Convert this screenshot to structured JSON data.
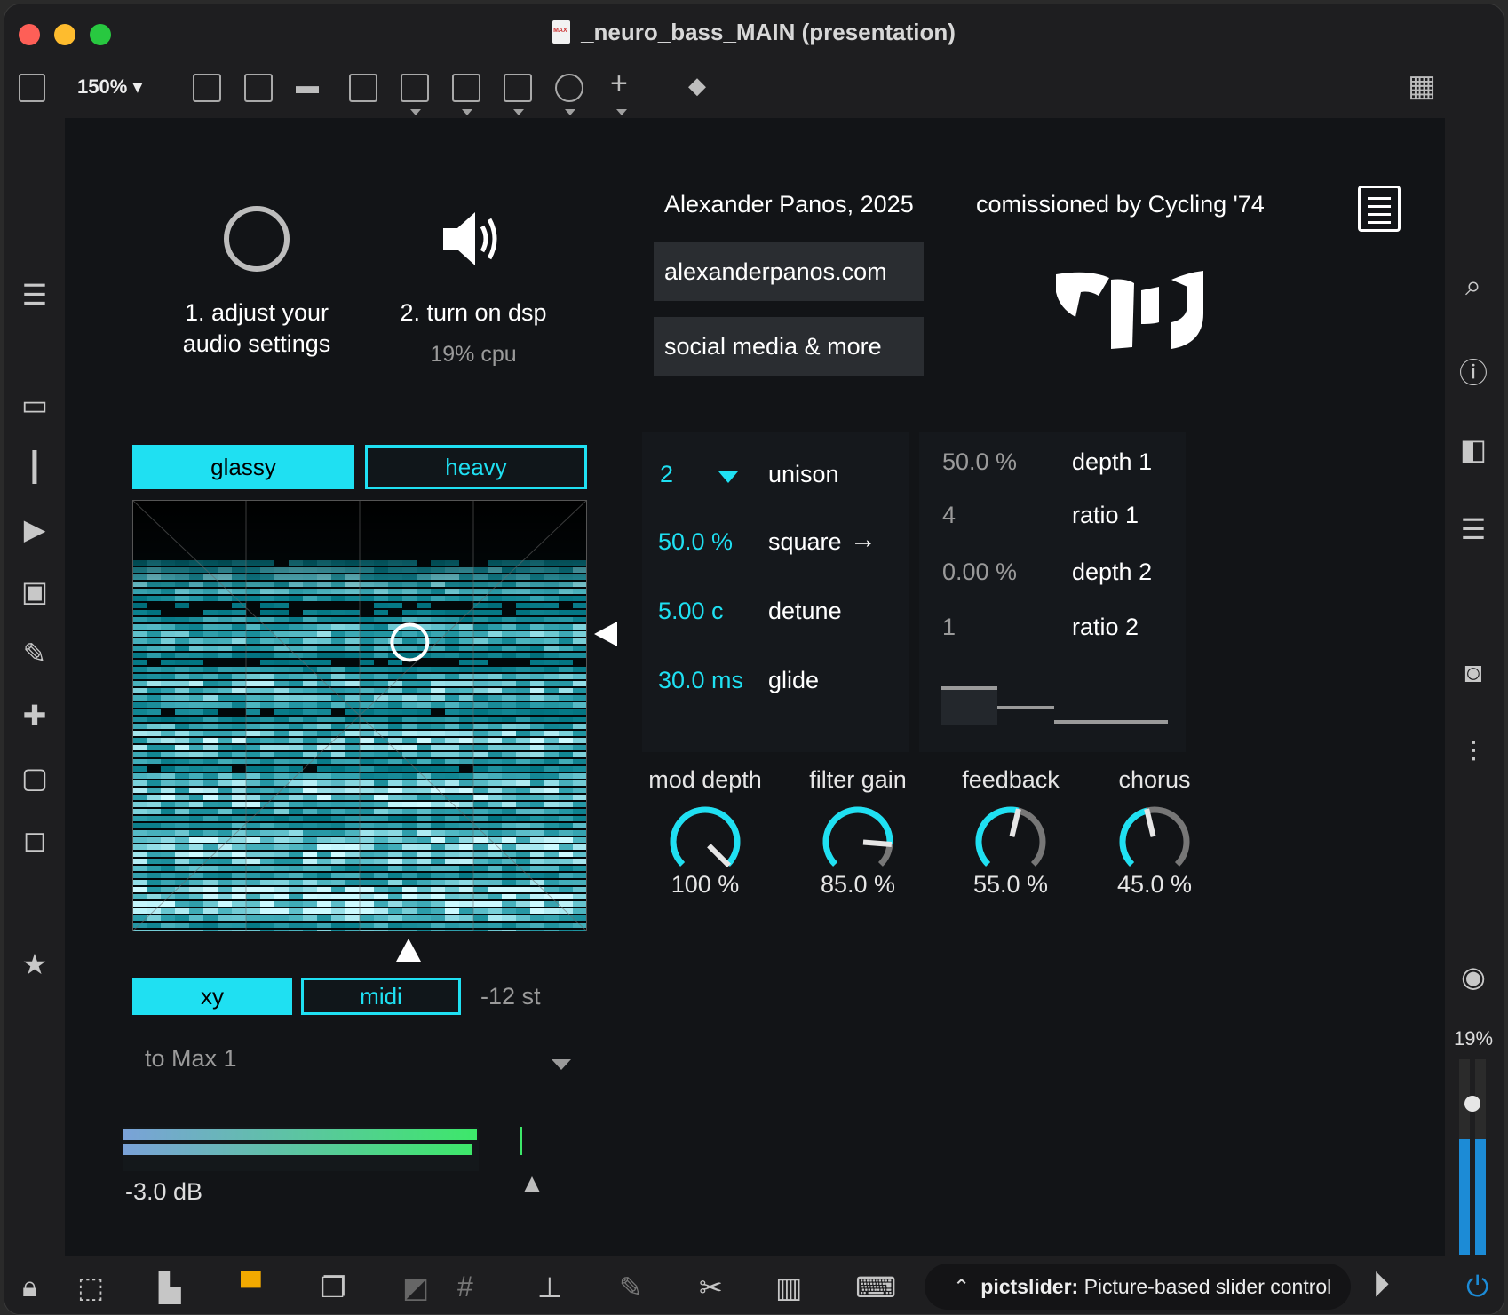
{
  "window": {
    "title": "_neuro_bass_MAIN (presentation)"
  },
  "toolbar": {
    "zoom": "150%"
  },
  "intro": {
    "step1_line1": "1. adjust your",
    "step1_line2": "audio settings",
    "step2": "2. turn on dsp",
    "cpu": "19% cpu"
  },
  "credits": {
    "author": "Alexander Panos, 2025",
    "commission": "comissioned by Cycling '74",
    "link1": "alexanderpanos.com",
    "link2": "social media & more"
  },
  "modes": {
    "tab1": "glassy",
    "tab2": "heavy"
  },
  "xy": {
    "puck_x": 0.61,
    "puck_y": 0.33
  },
  "input": {
    "tab1": "xy",
    "tab2": "midi",
    "transpose": "-12 st",
    "destination": "to Max 1"
  },
  "meter": {
    "level": "-3.0 dB"
  },
  "synth": [
    {
      "value": "2",
      "label": "unison"
    },
    {
      "value": "50.0 %",
      "label": "square"
    },
    {
      "value": "5.00 c",
      "label": "detune"
    },
    {
      "value": "30.0 ms",
      "label": "glide"
    }
  ],
  "fm": [
    {
      "value": "50.0 %",
      "label": "depth 1"
    },
    {
      "value": "4",
      "label": "ratio 1"
    },
    {
      "value": "0.00 %",
      "label": "depth 2"
    },
    {
      "value": "1",
      "label": "ratio 2"
    }
  ],
  "dials": [
    {
      "label": "mod depth",
      "value": "100 %",
      "amount": 1.0
    },
    {
      "label": "filter gain",
      "value": "85.0 %",
      "amount": 0.85
    },
    {
      "label": "feedback",
      "value": "55.0 %",
      "amount": 0.55
    },
    {
      "label": "chorus",
      "value": "45.0 %",
      "amount": 0.45
    }
  ],
  "master": {
    "cpu": "19%"
  },
  "status": {
    "object": "pictslider:",
    "description": "Picture-based slider control"
  },
  "colors": {
    "accent": "#1fe0f2",
    "background": "#121417"
  }
}
